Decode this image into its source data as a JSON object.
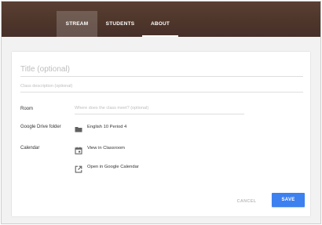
{
  "tabs": {
    "stream": "STREAM",
    "students": "STUDENTS",
    "about": "ABOUT",
    "active": "about"
  },
  "form": {
    "title_placeholder": "Title (optional)",
    "description_placeholder": "Class description (optional)",
    "room_label": "Room",
    "room_placeholder": "Where does the class meet? (optional)",
    "drive_label": "Google Drive folder",
    "drive_folder": "English 10 Period 4",
    "calendar_label": "Calendar",
    "view_in_classroom": "View in Classroom",
    "open_in_google_calendar": "Open in Google Calendar"
  },
  "actions": {
    "cancel": "CANCEL",
    "save": "SAVE"
  },
  "icons": {
    "drive": "folder-icon",
    "view": "calendar-icon",
    "external": "open-external-icon"
  },
  "colors": {
    "header": "#4d352a",
    "accent": "#3d80f0"
  }
}
